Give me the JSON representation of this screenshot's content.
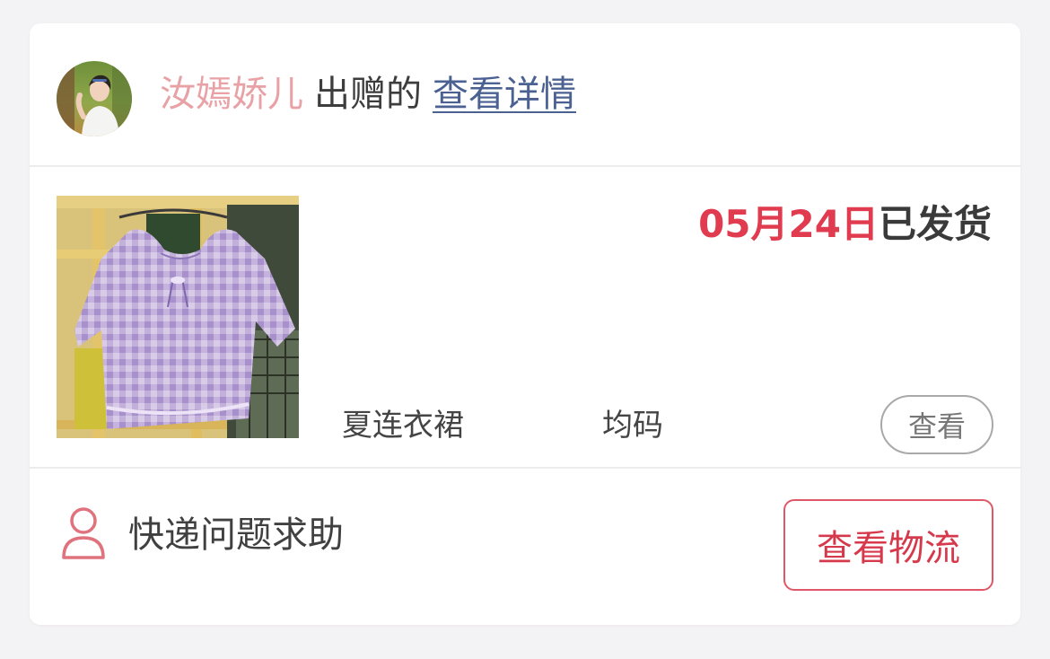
{
  "header": {
    "giver_name": "汝嫣娇儿",
    "verb": "出赠的",
    "detail_link": "查看详情",
    "avatar_icon": "user-photo-avatar"
  },
  "product": {
    "ship_date": "05月24日",
    "ship_status": "已发货",
    "item_name": "夏连衣裙",
    "item_size": "均码",
    "view_label": "查看",
    "image_icon": "lavender-blouse-photo"
  },
  "footer": {
    "help_label": "快递问题求助",
    "logistics_label": "查看物流",
    "help_icon": "user-icon"
  },
  "colors": {
    "accent_red": "#e03b4e",
    "giver_pink": "#e8a2a6",
    "link_blue": "#4a6192",
    "divider": "#ececef"
  }
}
